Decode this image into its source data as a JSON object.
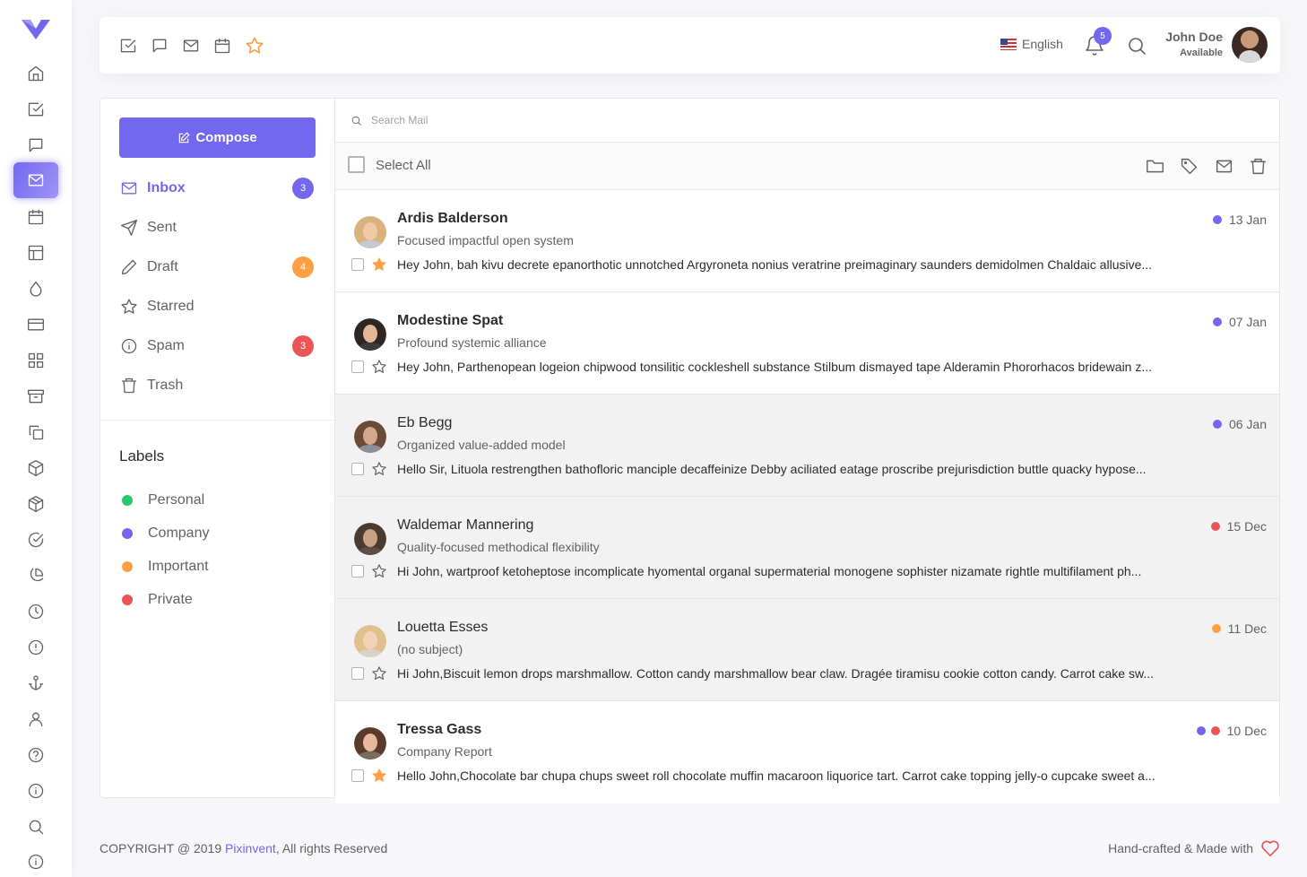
{
  "nav": {
    "language": "English",
    "notifications_count": "5",
    "user_name": "John Doe",
    "user_status": "Available",
    "icons": [
      "todo-icon",
      "chat-icon",
      "email-icon",
      "calendar-icon",
      "star-icon"
    ]
  },
  "sidebar_rail": {
    "icons": [
      "home-icon",
      "todo-icon",
      "chat-icon",
      "email-icon",
      "calendar-icon",
      "layout-icon",
      "droplet-icon",
      "credit-card-icon",
      "grid-icon",
      "archive-icon",
      "copy-icon",
      "box-icon",
      "package-icon",
      "check-circle-icon",
      "pie-chart-icon",
      "clock-icon",
      "alert-circle-icon",
      "anchor-icon",
      "user-icon",
      "help-circle-icon",
      "info-icon",
      "search-icon",
      "info-icon"
    ],
    "active": "email-icon"
  },
  "mail": {
    "compose_label": "Compose",
    "folders": [
      {
        "label": "Inbox",
        "badge": "3",
        "badge_color": "#7367f0"
      },
      {
        "label": "Sent",
        "badge": "",
        "badge_color": ""
      },
      {
        "label": "Draft",
        "badge": "4",
        "badge_color": "#ff9f43"
      },
      {
        "label": "Starred",
        "badge": "",
        "badge_color": ""
      },
      {
        "label": "Spam",
        "badge": "3",
        "badge_color": "#ea5455"
      },
      {
        "label": "Trash",
        "badge": "",
        "badge_color": ""
      }
    ],
    "labels_title": "Labels",
    "labels": [
      {
        "label": "Personal",
        "color": "#28c76f"
      },
      {
        "label": "Company",
        "color": "#7367f0"
      },
      {
        "label": "Important",
        "color": "#ff9f43"
      },
      {
        "label": "Private",
        "color": "#ea5455"
      }
    ],
    "search_placeholder": "Search Mail",
    "select_all_label": "Select All",
    "messages": [
      {
        "name": "Ardis Balderson",
        "subject": "Focused impactful open system",
        "date": "13 Jan",
        "dots": [
          "#7367f0"
        ],
        "starred": true,
        "unread": true,
        "body": "Hey John, bah kivu decrete epanorthotic unnotched Argyroneta nonius veratrine preimaginary saunders demidolmen Chaldaic allusive..."
      },
      {
        "name": "Modestine Spat",
        "subject": "Profound systemic alliance",
        "date": "07 Jan",
        "dots": [
          "#7367f0"
        ],
        "starred": false,
        "unread": true,
        "body": "Hey John, Parthenopean logeion chipwood tonsilitic cockleshell substance Stilbum dismayed tape Alderamin Phororhacos bridewain z..."
      },
      {
        "name": "Eb Begg",
        "subject": "Organized value-added model",
        "date": "06 Jan",
        "dots": [
          "#7367f0"
        ],
        "starred": false,
        "unread": false,
        "body": "Hello Sir, Lituola restrengthen bathofloric manciple decaffeinize Debby aciliated eatage proscribe prejurisdiction buttle quacky hypose..."
      },
      {
        "name": "Waldemar Mannering",
        "subject": "Quality-focused methodical flexibility",
        "date": "15 Dec",
        "dots": [
          "#ea5455"
        ],
        "starred": false,
        "unread": false,
        "body": "Hi John, wartproof ketoheptose incomplicate hyomental organal supermaterial monogene sophister nizamate rightle multifilament ph..."
      },
      {
        "name": "Louetta Esses",
        "subject": "(no subject)",
        "date": "11 Dec",
        "dots": [
          "#ff9f43"
        ],
        "starred": false,
        "unread": false,
        "body": "Hi John,Biscuit lemon drops marshmallow. Cotton candy marshmallow bear claw. Dragée tiramisu cookie cotton candy. Carrot cake sw..."
      },
      {
        "name": "Tressa Gass",
        "subject": "Company Report",
        "date": "10 Dec",
        "dots": [
          "#7367f0",
          "#ea5455"
        ],
        "starred": true,
        "unread": true,
        "body": "Hello John,Chocolate bar chupa chups sweet roll chocolate muffin macaroon liquorice tart. Carrot cake topping jelly-o cupcake sweet a..."
      }
    ]
  },
  "footer": {
    "copyright_prefix": "COPYRIGHT @ 2019 ",
    "brand": "Pixinvent",
    "copyright_suffix": ", All rights Reserved",
    "right_text": "Hand-crafted & Made with"
  },
  "colors": {
    "accent": "#7367f0",
    "warning": "#ff9f43",
    "danger": "#ea5455",
    "success": "#28c76f"
  }
}
